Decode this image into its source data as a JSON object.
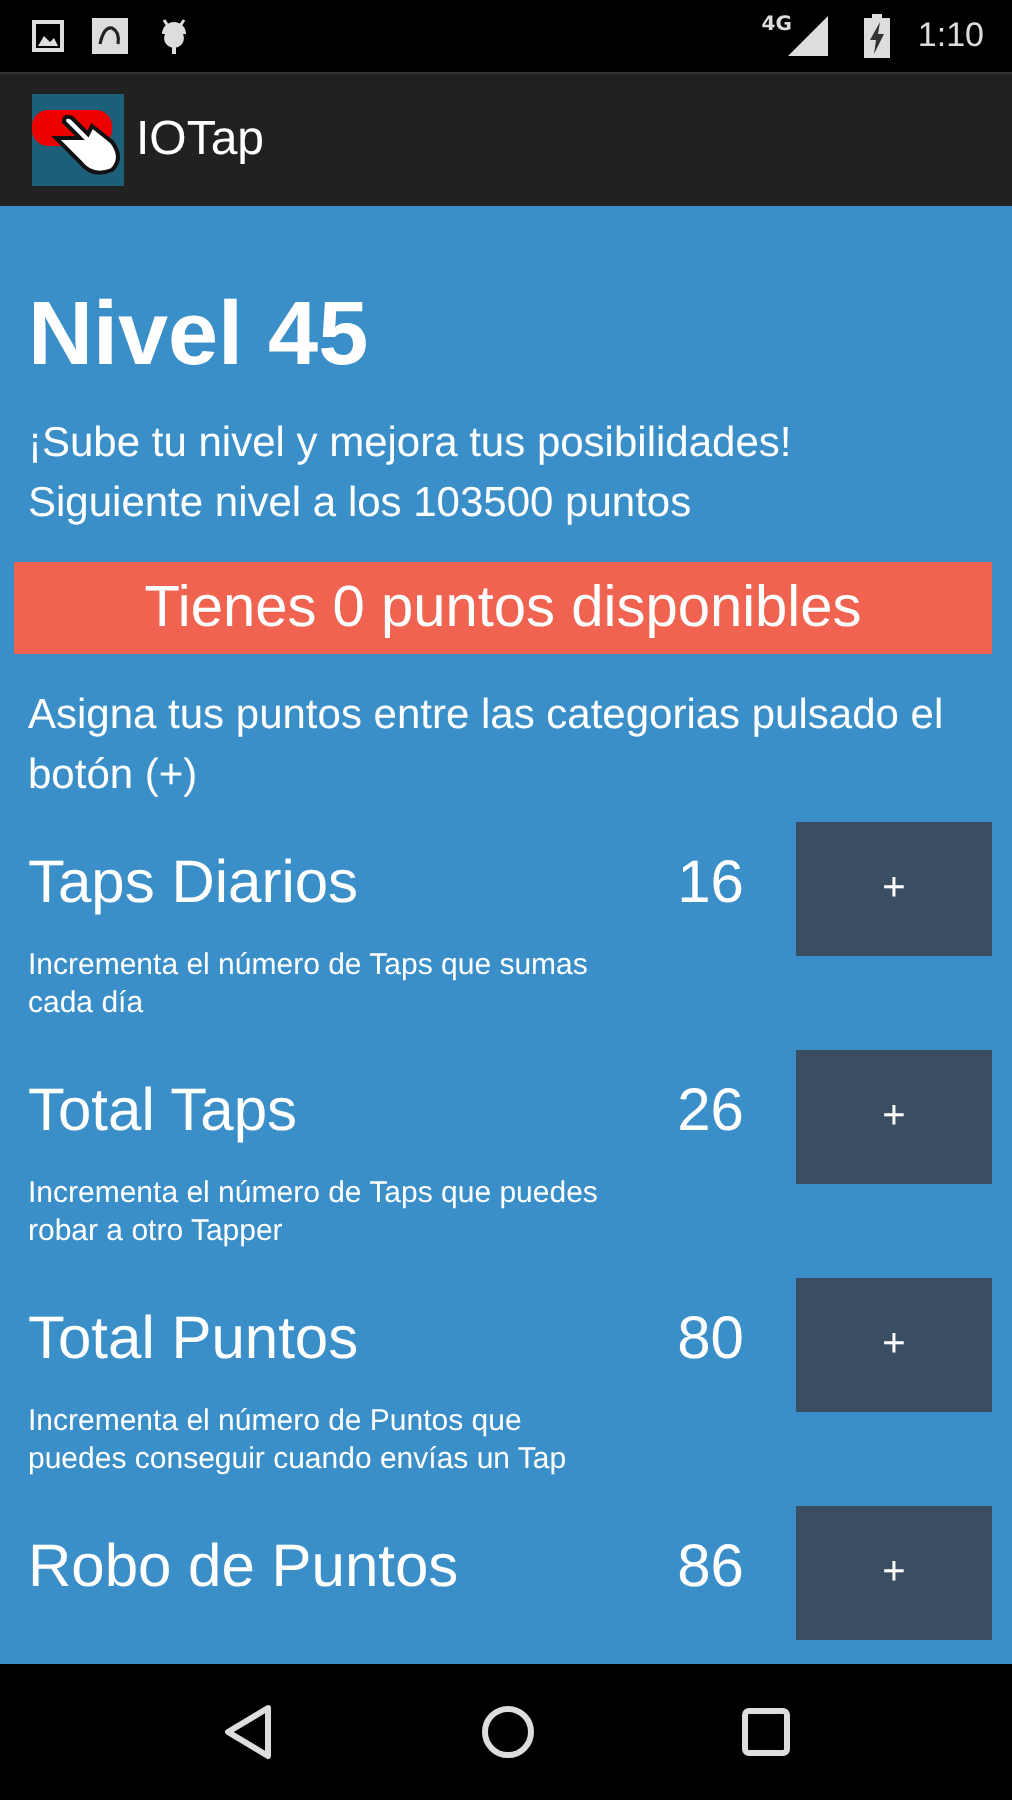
{
  "status_bar": {
    "network": "4G",
    "time": "1:10"
  },
  "app_bar": {
    "title": "IOTap"
  },
  "level_title": "Nivel 45",
  "intro": [
    "¡Sube tu nivel y mejora tus posibilidades!",
    "Siguiente nivel a los 103500 puntos"
  ],
  "points_banner": "Tienes 0 puntos disponibles",
  "instructions": "Asigna tus puntos entre las categorias pulsado el botón (+)",
  "categories": [
    {
      "name": "Taps Diarios",
      "value": "16",
      "button": "+",
      "description": "Incrementa el número de Taps que sumas cada día"
    },
    {
      "name": "Total Taps",
      "value": "26",
      "button": "+",
      "description": "Incrementa el número de Taps que puedes robar a otro Tapper"
    },
    {
      "name": "Total Puntos",
      "value": "80",
      "button": "+",
      "description": "Incrementa el número de Puntos que puedes conseguir cuando envías un Tap"
    },
    {
      "name": "Robo de Puntos",
      "value": "86",
      "button": "+"
    }
  ]
}
